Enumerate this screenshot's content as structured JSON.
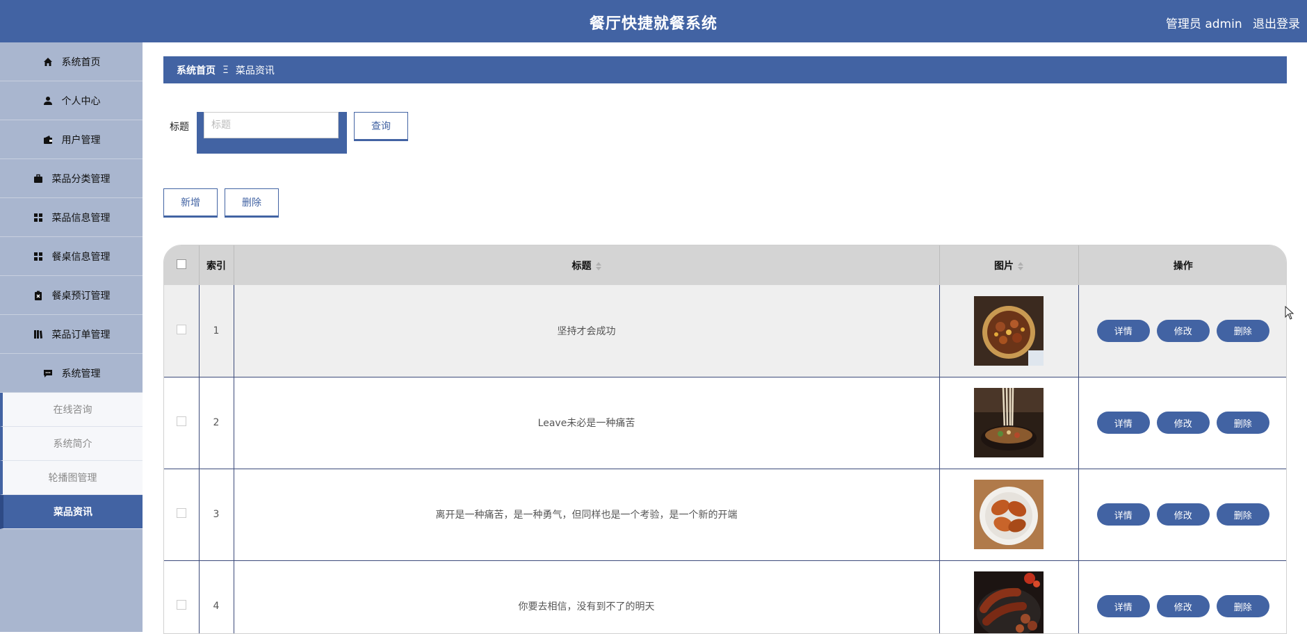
{
  "header": {
    "title": "餐厅快捷就餐系统",
    "role": "管理员 admin",
    "logout": "退出登录"
  },
  "sidebar": {
    "items": [
      {
        "label": "系统首页",
        "icon": "home-icon"
      },
      {
        "label": "个人中心",
        "icon": "user-icon"
      },
      {
        "label": "用户管理",
        "icon": "wallet-icon"
      },
      {
        "label": "菜品分类管理",
        "icon": "briefcase-icon"
      },
      {
        "label": "菜品信息管理",
        "icon": "grid-icon"
      },
      {
        "label": "餐桌信息管理",
        "icon": "grid-icon"
      },
      {
        "label": "餐桌预订管理",
        "icon": "clipboard-x-icon"
      },
      {
        "label": "菜品订单管理",
        "icon": "book-icon"
      },
      {
        "label": "系统管理",
        "icon": "chat-icon"
      }
    ],
    "subitems": [
      {
        "label": "在线咨询"
      },
      {
        "label": "系统简介"
      },
      {
        "label": "轮播图管理"
      },
      {
        "label": "菜品资讯",
        "active": true
      }
    ]
  },
  "breadcrumb": {
    "home": "系统首页",
    "separator": "Ξ",
    "current": "菜品资讯"
  },
  "search": {
    "label": "标题",
    "placeholder": "标题",
    "value": "",
    "button": "查询"
  },
  "actions": {
    "add": "新增",
    "delete": "删除"
  },
  "table": {
    "columns": {
      "index": "索引",
      "title": "标题",
      "image": "图片",
      "ops": "操作"
    },
    "rows": [
      {
        "index": "1",
        "title": "坚持才会成功",
        "image": "food-pot-image"
      },
      {
        "index": "2",
        "title": "Leave未必是一种痛苦",
        "image": "noodle-bowl-image"
      },
      {
        "index": "3",
        "title": "离开是一种痛苦，是一种勇气，但同样也是一个考验，是一个新的开端",
        "image": "chicken-legs-image"
      },
      {
        "index": "4",
        "title": "你要去相信，没有到不了的明天",
        "image": "sausage-image"
      }
    ],
    "row_buttons": {
      "detail": "详情",
      "edit": "修改",
      "delete": "删除"
    }
  },
  "colors": {
    "primary": "#4263a3",
    "sidebar_bg": "#a9b6cf",
    "header_row": "#d4d4d4"
  }
}
